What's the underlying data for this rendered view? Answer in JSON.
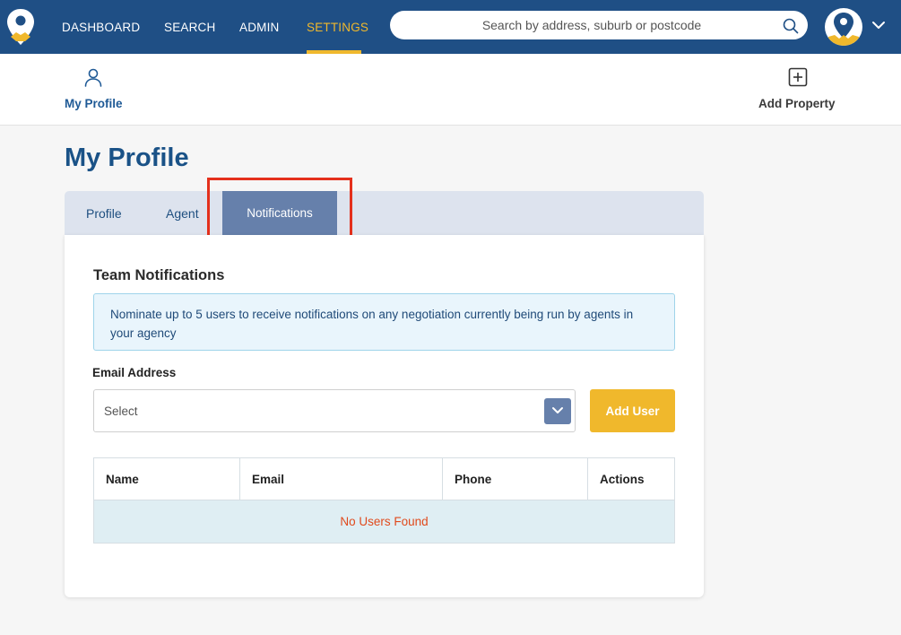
{
  "nav": {
    "items": [
      {
        "label": "DASHBOARD"
      },
      {
        "label": "SEARCH"
      },
      {
        "label": "ADMIN"
      },
      {
        "label": "SETTINGS",
        "active": true
      }
    ],
    "search_placeholder": "Search by address, suburb or postcode",
    "accent_color": "#f0b82c",
    "bar_color": "#1f4f85"
  },
  "subnav": {
    "profile_label": "My Profile",
    "add_property_label": "Add Property"
  },
  "page": {
    "title": "My Profile"
  },
  "tabs": [
    {
      "label": "Profile"
    },
    {
      "label": "Agent"
    },
    {
      "label": "Notifications",
      "active": true
    }
  ],
  "notifications": {
    "section_title": "Team Notifications",
    "info_text": "Nominate up to 5 users to receive notifications on any negotiation currently being run by agents in your agency",
    "email_label": "Email Address",
    "select_placeholder": "Select",
    "add_button_label": "Add User",
    "table": {
      "columns": [
        "Name",
        "Email",
        "Phone",
        "Actions"
      ],
      "empty_message": "No Users Found"
    }
  }
}
